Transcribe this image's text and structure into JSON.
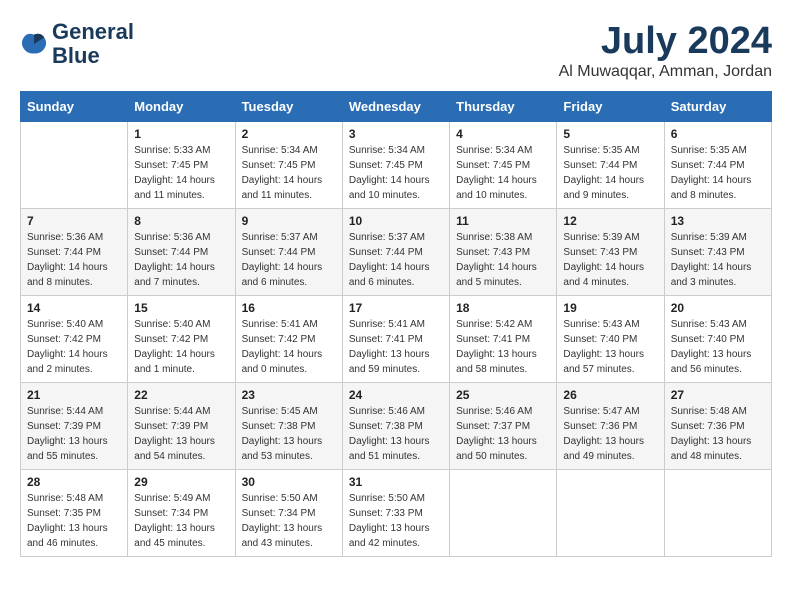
{
  "header": {
    "logo_line1": "General",
    "logo_line2": "Blue",
    "month": "July 2024",
    "location": "Al Muwaqqar, Amman, Jordan"
  },
  "weekdays": [
    "Sunday",
    "Monday",
    "Tuesday",
    "Wednesday",
    "Thursday",
    "Friday",
    "Saturday"
  ],
  "weeks": [
    [
      {
        "day": "",
        "info": ""
      },
      {
        "day": "1",
        "info": "Sunrise: 5:33 AM\nSunset: 7:45 PM\nDaylight: 14 hours\nand 11 minutes."
      },
      {
        "day": "2",
        "info": "Sunrise: 5:34 AM\nSunset: 7:45 PM\nDaylight: 14 hours\nand 11 minutes."
      },
      {
        "day": "3",
        "info": "Sunrise: 5:34 AM\nSunset: 7:45 PM\nDaylight: 14 hours\nand 10 minutes."
      },
      {
        "day": "4",
        "info": "Sunrise: 5:34 AM\nSunset: 7:45 PM\nDaylight: 14 hours\nand 10 minutes."
      },
      {
        "day": "5",
        "info": "Sunrise: 5:35 AM\nSunset: 7:44 PM\nDaylight: 14 hours\nand 9 minutes."
      },
      {
        "day": "6",
        "info": "Sunrise: 5:35 AM\nSunset: 7:44 PM\nDaylight: 14 hours\nand 8 minutes."
      }
    ],
    [
      {
        "day": "7",
        "info": "Sunrise: 5:36 AM\nSunset: 7:44 PM\nDaylight: 14 hours\nand 8 minutes."
      },
      {
        "day": "8",
        "info": "Sunrise: 5:36 AM\nSunset: 7:44 PM\nDaylight: 14 hours\nand 7 minutes."
      },
      {
        "day": "9",
        "info": "Sunrise: 5:37 AM\nSunset: 7:44 PM\nDaylight: 14 hours\nand 6 minutes."
      },
      {
        "day": "10",
        "info": "Sunrise: 5:37 AM\nSunset: 7:44 PM\nDaylight: 14 hours\nand 6 minutes."
      },
      {
        "day": "11",
        "info": "Sunrise: 5:38 AM\nSunset: 7:43 PM\nDaylight: 14 hours\nand 5 minutes."
      },
      {
        "day": "12",
        "info": "Sunrise: 5:39 AM\nSunset: 7:43 PM\nDaylight: 14 hours\nand 4 minutes."
      },
      {
        "day": "13",
        "info": "Sunrise: 5:39 AM\nSunset: 7:43 PM\nDaylight: 14 hours\nand 3 minutes."
      }
    ],
    [
      {
        "day": "14",
        "info": "Sunrise: 5:40 AM\nSunset: 7:42 PM\nDaylight: 14 hours\nand 2 minutes."
      },
      {
        "day": "15",
        "info": "Sunrise: 5:40 AM\nSunset: 7:42 PM\nDaylight: 14 hours\nand 1 minute."
      },
      {
        "day": "16",
        "info": "Sunrise: 5:41 AM\nSunset: 7:42 PM\nDaylight: 14 hours\nand 0 minutes."
      },
      {
        "day": "17",
        "info": "Sunrise: 5:41 AM\nSunset: 7:41 PM\nDaylight: 13 hours\nand 59 minutes."
      },
      {
        "day": "18",
        "info": "Sunrise: 5:42 AM\nSunset: 7:41 PM\nDaylight: 13 hours\nand 58 minutes."
      },
      {
        "day": "19",
        "info": "Sunrise: 5:43 AM\nSunset: 7:40 PM\nDaylight: 13 hours\nand 57 minutes."
      },
      {
        "day": "20",
        "info": "Sunrise: 5:43 AM\nSunset: 7:40 PM\nDaylight: 13 hours\nand 56 minutes."
      }
    ],
    [
      {
        "day": "21",
        "info": "Sunrise: 5:44 AM\nSunset: 7:39 PM\nDaylight: 13 hours\nand 55 minutes."
      },
      {
        "day": "22",
        "info": "Sunrise: 5:44 AM\nSunset: 7:39 PM\nDaylight: 13 hours\nand 54 minutes."
      },
      {
        "day": "23",
        "info": "Sunrise: 5:45 AM\nSunset: 7:38 PM\nDaylight: 13 hours\nand 53 minutes."
      },
      {
        "day": "24",
        "info": "Sunrise: 5:46 AM\nSunset: 7:38 PM\nDaylight: 13 hours\nand 51 minutes."
      },
      {
        "day": "25",
        "info": "Sunrise: 5:46 AM\nSunset: 7:37 PM\nDaylight: 13 hours\nand 50 minutes."
      },
      {
        "day": "26",
        "info": "Sunrise: 5:47 AM\nSunset: 7:36 PM\nDaylight: 13 hours\nand 49 minutes."
      },
      {
        "day": "27",
        "info": "Sunrise: 5:48 AM\nSunset: 7:36 PM\nDaylight: 13 hours\nand 48 minutes."
      }
    ],
    [
      {
        "day": "28",
        "info": "Sunrise: 5:48 AM\nSunset: 7:35 PM\nDaylight: 13 hours\nand 46 minutes."
      },
      {
        "day": "29",
        "info": "Sunrise: 5:49 AM\nSunset: 7:34 PM\nDaylight: 13 hours\nand 45 minutes."
      },
      {
        "day": "30",
        "info": "Sunrise: 5:50 AM\nSunset: 7:34 PM\nDaylight: 13 hours\nand 43 minutes."
      },
      {
        "day": "31",
        "info": "Sunrise: 5:50 AM\nSunset: 7:33 PM\nDaylight: 13 hours\nand 42 minutes."
      },
      {
        "day": "",
        "info": ""
      },
      {
        "day": "",
        "info": ""
      },
      {
        "day": "",
        "info": ""
      }
    ]
  ]
}
